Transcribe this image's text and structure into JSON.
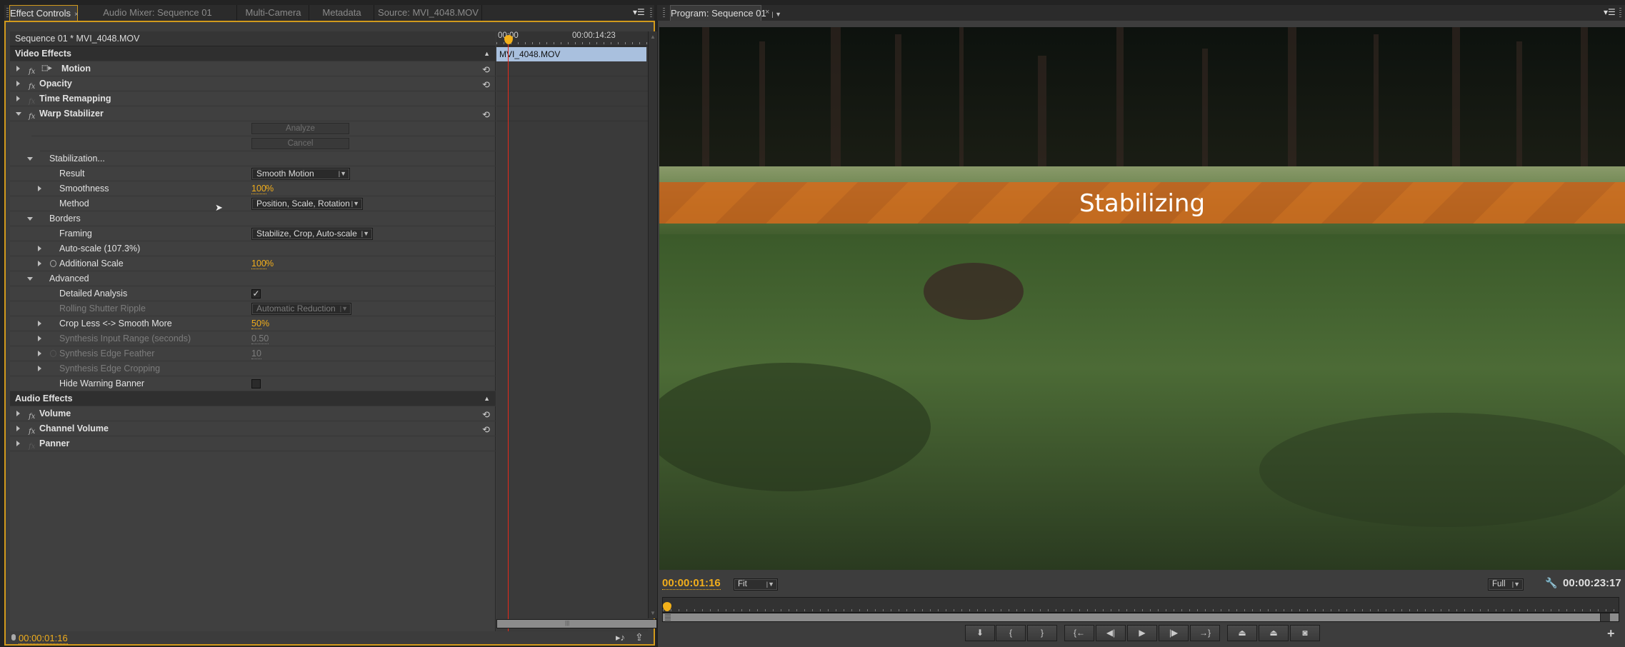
{
  "left_panel": {
    "tabs": [
      {
        "label": "Effect Controls",
        "active": true,
        "closable": true
      },
      {
        "label": "Audio Mixer: Sequence 01",
        "active": false
      },
      {
        "label": "Multi-Camera",
        "active": false
      },
      {
        "label": "Metadata",
        "active": false
      },
      {
        "label": "Source: MVI_4048.MOV",
        "active": false
      }
    ],
    "close_glyph": "×",
    "menu_icon": "panel-menu-icon",
    "sequence_header": "Sequence 01 * MVI_4048.MOV",
    "video_effects_title": "Video Effects",
    "audio_effects_title": "Audio Effects",
    "effects": {
      "motion": "Motion",
      "opacity": "Opacity",
      "time_remapping": "Time Remapping",
      "warp_stabilizer": "Warp Stabilizer",
      "analyze_button": "Analyze",
      "cancel_button": "Cancel",
      "stabilization": "Stabilization...",
      "result_label": "Result",
      "result_value": "Smooth Motion",
      "smoothness_label": "Smoothness",
      "smoothness_value": "100",
      "method_label": "Method",
      "method_value": "Position, Scale, Rotation",
      "borders": "Borders",
      "framing_label": "Framing",
      "framing_value": "Stabilize, Crop, Auto-scale",
      "autoscale_label": "Auto-scale (107.3%)",
      "additional_scale_label": "Additional Scale",
      "additional_scale_value": "100",
      "advanced": "Advanced",
      "detailed_analysis_label": "Detailed Analysis",
      "detailed_analysis_checked": true,
      "rolling_shutter_label": "Rolling Shutter Ripple",
      "rolling_shutter_value": "Automatic Reduction",
      "crop_less_label": "Crop Less <-> Smooth More",
      "crop_less_value": "50",
      "synthesis_input_label": "Synthesis Input Range (seconds)",
      "synthesis_input_value": "0.50",
      "synthesis_feather_label": "Synthesis Edge Feather",
      "synthesis_feather_value": "10",
      "synthesis_cropping_label": "Synthesis Edge Cropping",
      "hide_warning_label": "Hide Warning Banner",
      "hide_warning_checked": false,
      "volume": "Volume",
      "channel_volume": "Channel Volume",
      "panner": "Panner"
    },
    "percent_sign": "%",
    "check_glyph": "✓",
    "fx_glyph": "fx",
    "reset_glyph": "⟲",
    "timeline": {
      "start_time": "00:00",
      "end_time": "00:00:14:23",
      "clip_name": "MVI_4048.MOV"
    },
    "footer_timecode": "00:00:01:16"
  },
  "program_panel": {
    "tab_label": "Program: Sequence 01",
    "close_glyph": "×",
    "banner_text": "Stabilizing",
    "current_timecode": "00:00:01:16",
    "zoom_value": "Fit",
    "resolution_value": "Full",
    "duration_timecode": "00:00:23:17",
    "transport_buttons": [
      {
        "name": "add-marker",
        "glyph": "⬇"
      },
      {
        "name": "mark-in",
        "glyph": "{"
      },
      {
        "name": "mark-out",
        "glyph": "}"
      },
      {
        "name": "go-to-in",
        "glyph": "{←"
      },
      {
        "name": "step-back",
        "glyph": "◀|"
      },
      {
        "name": "play",
        "glyph": "▶"
      },
      {
        "name": "step-forward",
        "glyph": "|▶"
      },
      {
        "name": "go-to-out",
        "glyph": "→}"
      },
      {
        "name": "lift",
        "glyph": "⏏"
      },
      {
        "name": "extract",
        "glyph": "⏏"
      },
      {
        "name": "export-frame",
        "glyph": "◙"
      }
    ],
    "add_button_glyph": "+",
    "wrench_glyph": "🔧"
  },
  "colors": {
    "accent": "#f0ad1c",
    "panel_border_active": "#d29a1c",
    "clip": "#a9c0de",
    "playhead": "#e52a1a",
    "banner": "#d2691e"
  }
}
